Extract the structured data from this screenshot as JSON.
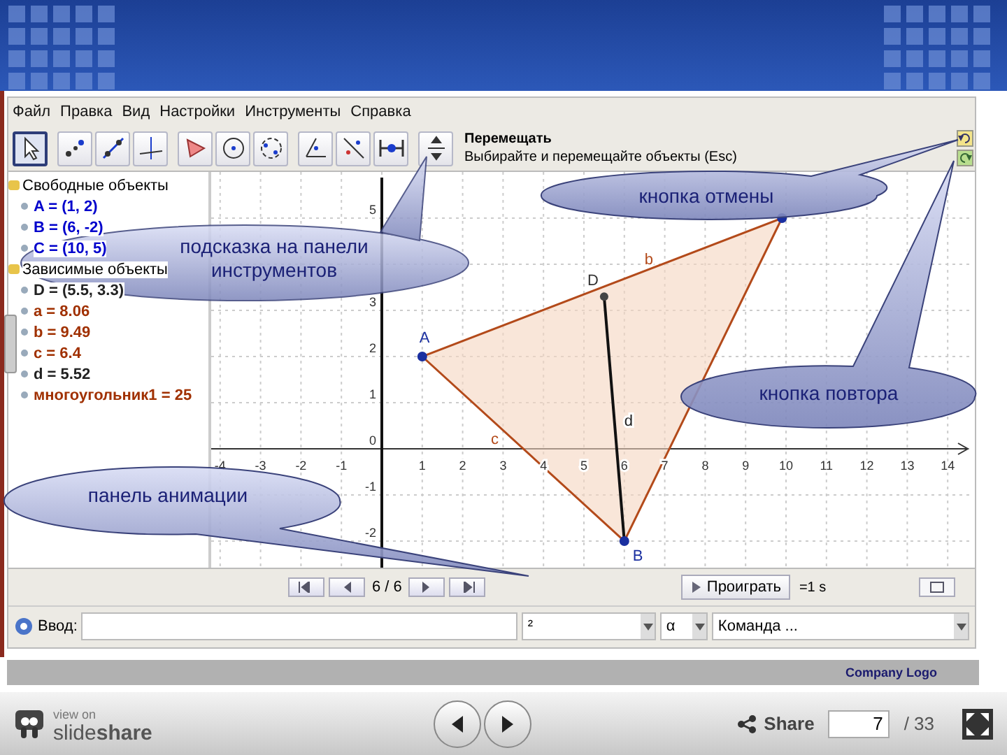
{
  "app": {
    "menu": [
      "Файл",
      "Правка",
      "Вид",
      "Настройки",
      "Инструменты",
      "Справка"
    ],
    "tools": [
      {
        "kind": "move",
        "selected": true
      },
      {
        "kind": "point",
        "selected": false
      },
      {
        "kind": "line",
        "selected": false
      },
      {
        "kind": "perpendicular",
        "selected": false
      },
      {
        "kind": "polygon",
        "selected": false
      },
      {
        "kind": "circle",
        "selected": false
      },
      {
        "kind": "ellipse",
        "selected": false
      },
      {
        "kind": "angle",
        "selected": false
      },
      {
        "kind": "reflect",
        "selected": false
      },
      {
        "kind": "slider",
        "selected": false
      },
      {
        "kind": "pan",
        "selected": false
      }
    ],
    "tool_tip": {
      "title": "Перемещать",
      "description": "Выбирайте и перемещайте объекты (Esc)"
    },
    "algebra": [
      {
        "label": "Свободные объекты",
        "children": [
          {
            "text": "A = (1, 2)",
            "color": "#0000cc"
          },
          {
            "text": "B = (6, -2)",
            "color": "#0000cc"
          },
          {
            "text": "C = (10, 5)",
            "color": "#0000cc"
          }
        ]
      },
      {
        "label": "Зависимые объекты",
        "children": [
          {
            "text": "D = (5.5, 3.3)",
            "color": "#222222"
          },
          {
            "text": "a = 8.06",
            "color": "#a03000"
          },
          {
            "text": "b = 9.49",
            "color": "#a03000"
          },
          {
            "text": "c = 6.4",
            "color": "#a03000"
          },
          {
            "text": "d = 5.52",
            "color": "#222222"
          },
          {
            "text": "многоугольник1 = 25",
            "color": "#a03000"
          }
        ]
      }
    ],
    "graphics": {
      "x_labels": [
        "-4",
        "-3",
        "-2",
        "-1",
        "1",
        "2",
        "3",
        "4",
        "5",
        "6",
        "7",
        "8",
        "9",
        "10",
        "11",
        "12",
        "13",
        "14"
      ],
      "y_labels": [
        "5",
        "3",
        "2",
        "1",
        "0",
        "-1",
        "-2"
      ],
      "point_labels": [
        "A",
        "B",
        "D"
      ],
      "segment_labels": [
        "b",
        "c",
        "d"
      ]
    },
    "animation": {
      "counter": "6 / 6",
      "play": "Проиграть",
      "speed": "=1 s"
    },
    "input_bar": {
      "label": "Ввод:",
      "symbol_menu": "²",
      "greek_menu": "α",
      "command_menu": "Команда ..."
    }
  },
  "callouts": [
    "подсказка на панели инструментов",
    "кнопка отмены",
    "кнопка повтора",
    "панель анимации"
  ],
  "footer": {
    "company_logo": "Company Logo"
  },
  "viewer": {
    "view_on": "view on",
    "brand": "slide**share**",
    "share": "Share",
    "page": "7",
    "total": "/ 33"
  }
}
